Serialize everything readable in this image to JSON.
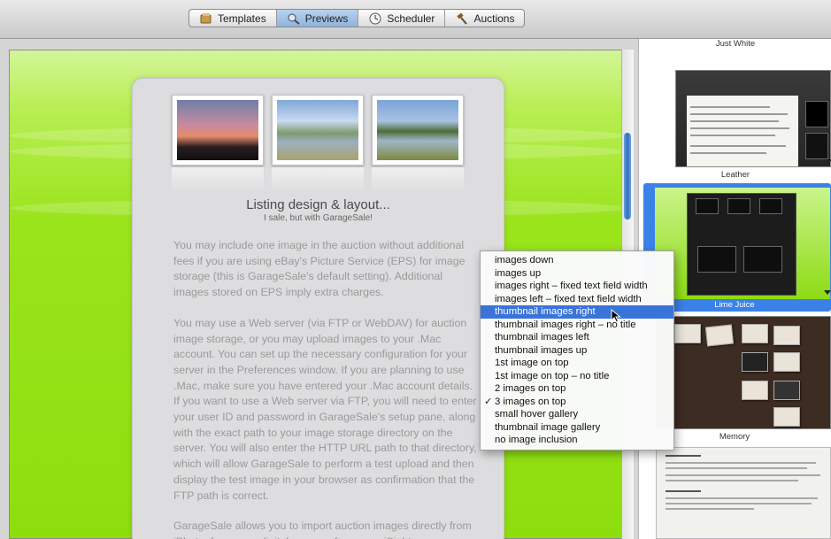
{
  "toolbar": {
    "tabs": [
      {
        "label": "Templates",
        "icon": "templates-icon"
      },
      {
        "label": "Previews",
        "icon": "previews-icon",
        "active": true
      },
      {
        "label": "Scheduler",
        "icon": "scheduler-icon"
      },
      {
        "label": "Auctions",
        "icon": "auctions-icon"
      }
    ]
  },
  "preview": {
    "title": "Listing design & layout...",
    "subtitle": "I sale, but with GarageSale!",
    "paragraphs": [
      "You may include one image in the auction without additional fees if you are using eBay's Picture Service (EPS) for image storage (this is GarageSale's default setting). Additional images stored on EPS imply extra charges.",
      "You may use a Web server (via FTP or WebDAV) for auction image storage, or you may upload images to your .Mac account. You can set up the necessary configuration for your server in the Preferences window. If you are planning to use .Mac, make sure you have entered your .Mac account details. If you want to use a Web server via FTP, you will need to enter your user ID and password in GarageSale's setup pane, along with the exact path to your image storage directory on the server. You will also enter the HTTP URL path to that directory, which will allow GarageSale to perform a test upload and then display the test image in your browser as confirmation that the FTP path is correct.",
      "GarageSale allows you to import auction images directly from iPhoto, from your digital camera, from your iSight camera or"
    ]
  },
  "sidebar": {
    "templates": [
      {
        "label": "Just White"
      },
      {
        "label": "Leather"
      },
      {
        "label": "Lime Juice",
        "selected": true
      },
      {
        "label": "Memory"
      }
    ]
  },
  "menu": {
    "items": [
      {
        "label": "images down"
      },
      {
        "label": "images up"
      },
      {
        "label": "images right – fixed text field width"
      },
      {
        "label": "images left – fixed text field width"
      },
      {
        "label": "thumbnail images right",
        "highlighted": true
      },
      {
        "label": "thumbnail images right – no title"
      },
      {
        "label": "thumbnail images left"
      },
      {
        "label": "thumbnail images up"
      },
      {
        "label": "1st image on top"
      },
      {
        "label": "1st image on top – no title"
      },
      {
        "label": "2 images on top"
      },
      {
        "label": "3 images on top",
        "checked": true
      },
      {
        "label": "small hover gallery"
      },
      {
        "label": "thumbnail image gallery"
      },
      {
        "label": "no image inclusion"
      }
    ],
    "check_mark": "✓"
  },
  "colors": {
    "lime_bg": "#8ede0e",
    "selection_blue": "#3a73d9",
    "body_text": "#9a9a9a"
  }
}
